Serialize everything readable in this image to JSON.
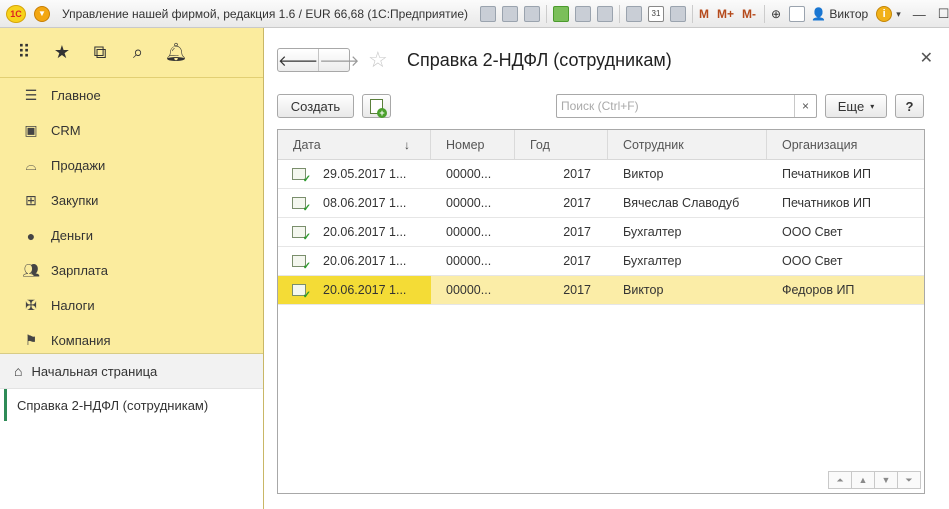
{
  "titlebar": {
    "logo": "1С",
    "title": "Управление нашей фирмой, редакция 1.6 / EUR 66,68  (1С:Предприятие)",
    "m": "M",
    "m_plus": "M+",
    "m_minus": "M-",
    "user": "Виктор",
    "info": "i"
  },
  "sidebar": {
    "sections": [
      {
        "label": "Главное",
        "icon": "menu-lines-icon"
      },
      {
        "label": "CRM",
        "icon": "contact-card-icon"
      },
      {
        "label": "Продажи",
        "icon": "basket-icon"
      },
      {
        "label": "Закупки",
        "icon": "cart-icon"
      },
      {
        "label": "Деньги",
        "icon": "coin-icon"
      },
      {
        "label": "Зарплата",
        "icon": "people-icon"
      },
      {
        "label": "Налоги",
        "icon": "emblem-icon"
      },
      {
        "label": "Компания",
        "icon": "flag-icon"
      }
    ],
    "home": "Начальная страница",
    "open_window": "Справка 2-НДФЛ (сотрудникам)"
  },
  "form": {
    "title": "Справка 2-НДФЛ (сотрудникам)",
    "create_label": "Создать",
    "search_placeholder": "Поиск (Ctrl+F)",
    "more_label": "Еще",
    "help_label": "?"
  },
  "table": {
    "columns": [
      "Дата",
      "Номер",
      "Год",
      "Сотрудник",
      "Организация"
    ],
    "rows": [
      {
        "date": "29.05.2017 1...",
        "number": "00000...",
        "year": "2017",
        "employee": "Виктор",
        "org": "Печатников ИП",
        "selected": false
      },
      {
        "date": "08.06.2017 1...",
        "number": "00000...",
        "year": "2017",
        "employee": "Вячеслав Славодуб",
        "org": "Печатников ИП",
        "selected": false
      },
      {
        "date": "20.06.2017 1...",
        "number": "00000...",
        "year": "2017",
        "employee": "Бухгалтер",
        "org": "ООО Свет",
        "selected": false
      },
      {
        "date": "20.06.2017 1...",
        "number": "00000...",
        "year": "2017",
        "employee": "Бухгалтер",
        "org": "ООО Свет",
        "selected": false
      },
      {
        "date": "20.06.2017 1...",
        "number": "00000...",
        "year": "2017",
        "employee": "Виктор",
        "org": "Федоров ИП",
        "selected": true
      }
    ]
  },
  "colors": {
    "sidebar_bg": "#fbec9e",
    "selected_row": "#fbeda7",
    "selected_cell": "#f4dc36"
  }
}
